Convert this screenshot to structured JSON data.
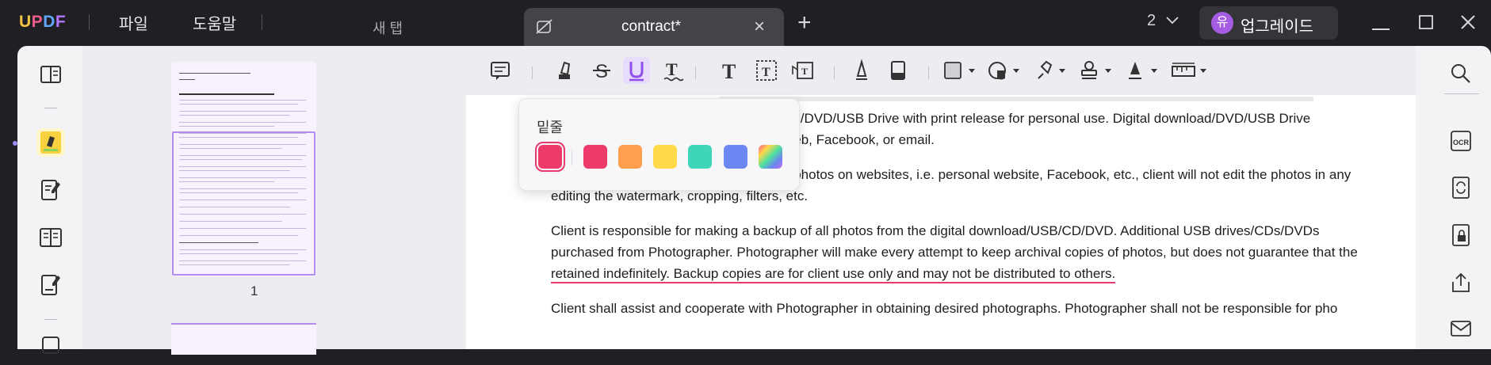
{
  "titlebar": {
    "logo": {
      "u": "U",
      "p": "P",
      "d": "D",
      "f": "F"
    },
    "menu": [
      "파일",
      "도움말"
    ],
    "new_tab_label": "새 탭",
    "active_tab": {
      "title": "contract*"
    },
    "window_count": "2",
    "upgrade": {
      "avatar_letter": "유",
      "label": "업그레이드"
    }
  },
  "thumbnails": [
    {
      "page_number": "1"
    }
  ],
  "popup": {
    "title": "밑줄",
    "swatches": [
      "#ec3a6b",
      "#ff9e4d",
      "#ffd94a",
      "#3fd5b8",
      "#6c86f2",
      "rainbow"
    ],
    "selected_color": "#ec3a6b"
  },
  "document": {
    "para1": [
      "download/DVD/USB Drive with print release for personal use. Digital download/DVD/USB Drive",
      "on the web, Facebook, or email."
    ],
    "para2": [
      "Client understands that when publishing photos on websites, i.e. personal website, Facebook, etc., client will not edit the photos in any",
      "editing the watermark, cropping, filters, etc."
    ],
    "para3": [
      "Client is responsible for making a backup of all photos from the digital download/USB/CD/DVD. Additional USB drives/CDs/DVDs",
      "purchased from Photographer. Photographer will make every attempt to keep archival copies of photos, but does not guarantee that the",
      "retained indefinitely. Backup copies are for client use only and may not be distributed to others."
    ],
    "para4_partial": "Client shall assist and cooperate with Photographer in obtaining desired photographs. Photographer shall not be responsible for pho"
  },
  "colors": {
    "accent": "#b38cf0",
    "underline": "#e8396b",
    "titlebar": "#1f1f24"
  }
}
